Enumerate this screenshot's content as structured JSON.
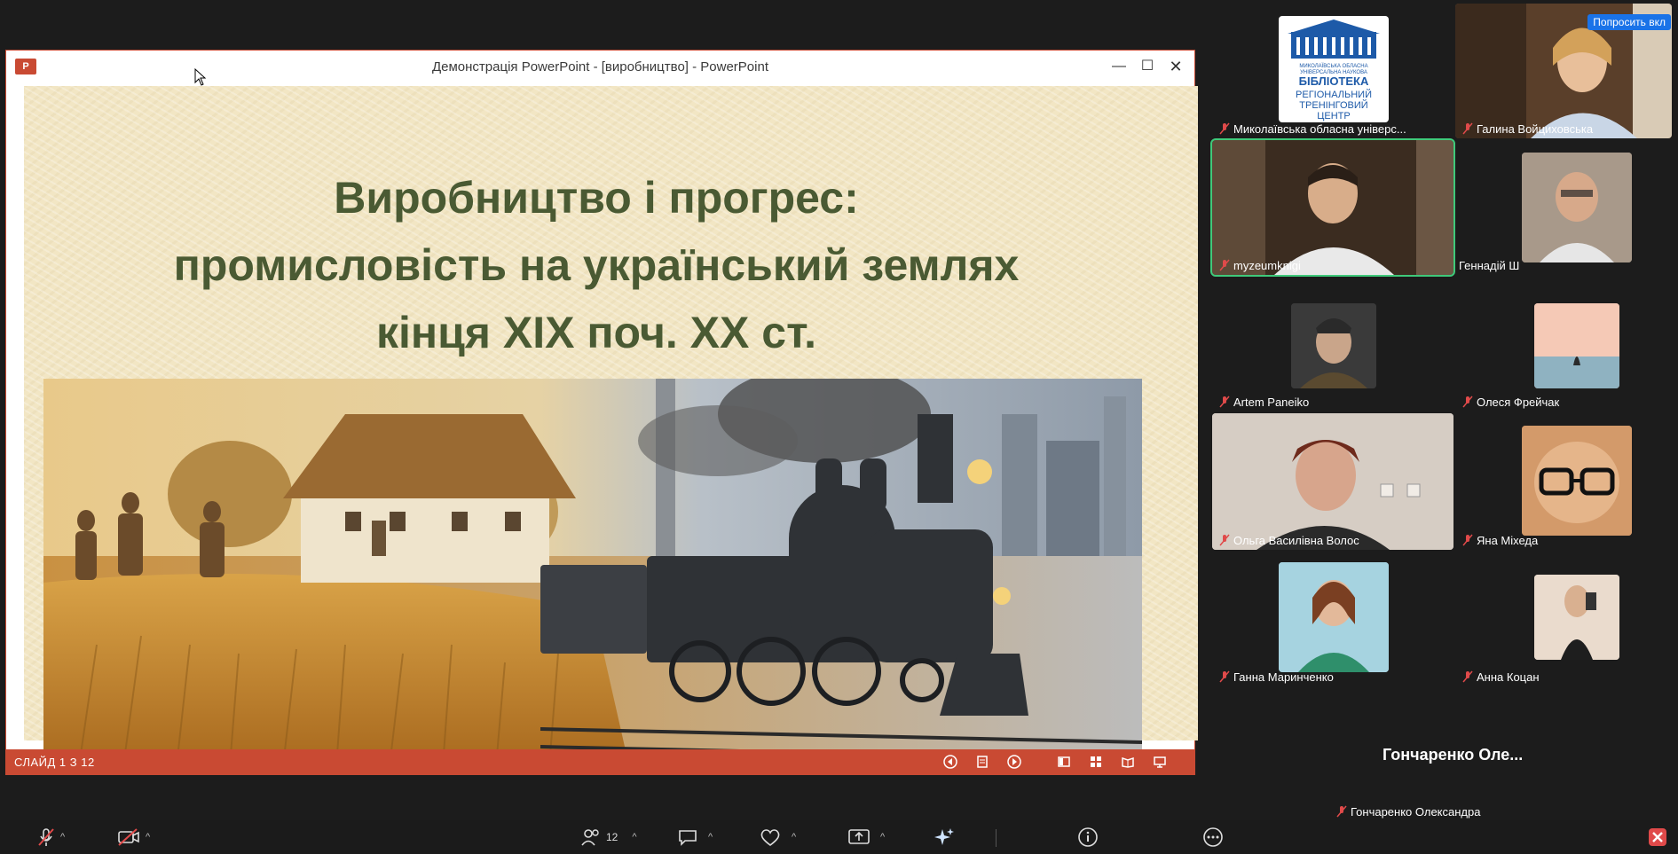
{
  "window": {
    "logo": "P",
    "title": "Демонстрація PowerPoint - [виробництво] - PowerPoint",
    "minimize": "—",
    "maximize": "☐",
    "close": "✕"
  },
  "slide": {
    "title_line1": "Виробництво і прогрес:",
    "title_line2": "промисловість на український  землях",
    "title_line3": "кінця XIX поч. XX ст.",
    "counter": "СЛАЙД 1 З 12",
    "title_color": "#4a5a33"
  },
  "participants": [
    {
      "name": "Миколаївська обласна універс...",
      "muted": true,
      "logo_lines": [
        "МИКОЛАЇВСЬКА ОБЛАСНА",
        "УНІВЕРСАЛЬНА НАУКОВА",
        "БІБЛІОТЕКА",
        "РЕГІОНАЛЬНИЙ",
        "ТРЕНІНГОВИЙ",
        "ЦЕНТР"
      ]
    },
    {
      "name": "Галина Войциховська",
      "muted": true
    },
    {
      "name": "myzeumknigi",
      "muted": true,
      "active": true
    },
    {
      "name": "Геннадій Ш",
      "muted": false
    },
    {
      "name": "Artem Paneiko",
      "muted": true
    },
    {
      "name": "Олеся Фрейчак",
      "muted": true
    },
    {
      "name": "Ольга Василівна Волос",
      "muted": true
    },
    {
      "name": "Яна Міхеда",
      "muted": true
    },
    {
      "name": "Ганна Маринченко",
      "muted": true
    },
    {
      "name": "Анна Коцан",
      "muted": true
    }
  ],
  "ask_button": "Попросить вкл",
  "screen_sharer": {
    "display": "Гончаренко  Оле...",
    "name": "Гончаренко Олександра"
  },
  "toolbar": {
    "participants_count": "12"
  },
  "colors": {
    "accent_red": "#c94a33",
    "active_border": "#3fc97a",
    "ask_blue": "#1a73e8"
  }
}
